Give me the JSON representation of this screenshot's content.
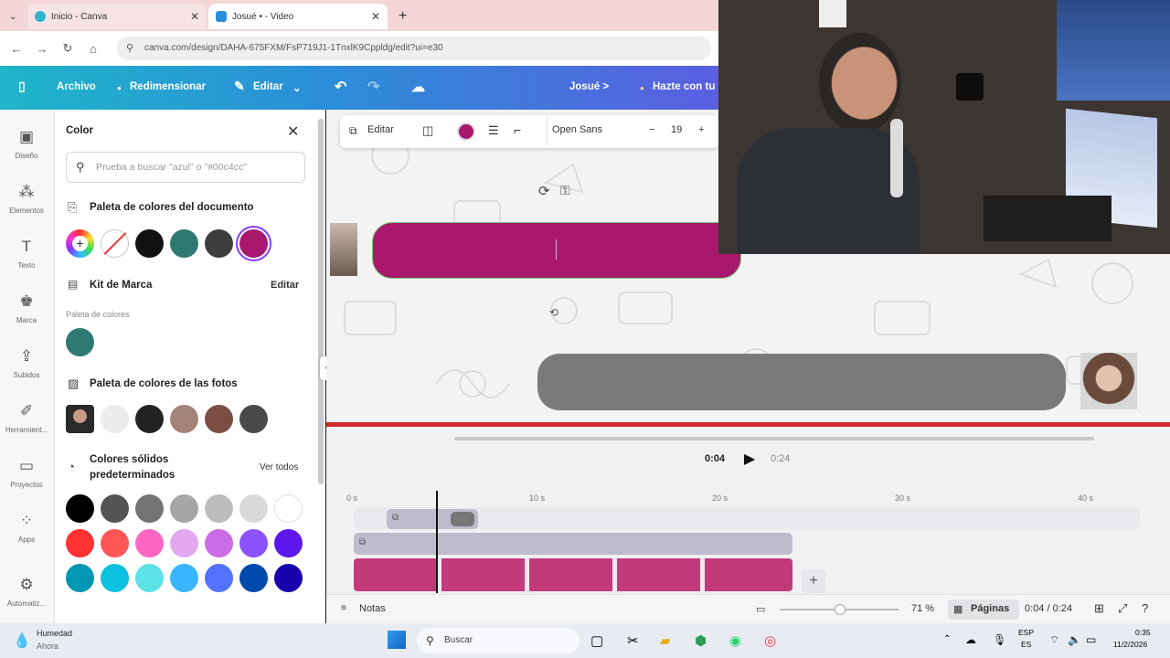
{
  "browser": {
    "tabs": [
      {
        "label": "Inicio - Canva"
      },
      {
        "label": "Josué • - Video"
      }
    ],
    "new_tab": "+",
    "url": "canva.com/design/DAHA-675FXM/FsP719J1-1TnxlK9Cppldg/edit?ui=e30"
  },
  "header": {
    "archivo": "Archivo",
    "redimensionar": "Redimensionar",
    "editar": "Editar",
    "title": "Josué >",
    "upgrade": "Hazte con tu"
  },
  "rail": [
    {
      "label": "Diseño",
      "icon": "design-icon"
    },
    {
      "label": "Elementos",
      "icon": "elements-icon"
    },
    {
      "label": "Texto",
      "icon": "text-icon"
    },
    {
      "label": "Marca",
      "icon": "brand-icon"
    },
    {
      "label": "Subidos",
      "icon": "upload-icon"
    },
    {
      "label": "Herramient...",
      "icon": "tools-icon"
    },
    {
      "label": "Proyectos",
      "icon": "folder-icon"
    },
    {
      "label": "Apps",
      "icon": "apps-icon"
    },
    {
      "label": "Automatiz...",
      "icon": "automation-icon"
    }
  ],
  "panel": {
    "title": "Color",
    "search_placeholder": "Prueba a buscar \"azul\" o \"#00c4cc\"",
    "doc_palette_title": "Paleta de colores del documento",
    "doc_palette": [
      "#121212",
      "#2e7a72",
      "#3d3d3d",
      "#a8186f"
    ],
    "brand_kit_title": "Kit de Marca",
    "brand_kit_edit": "Editar",
    "brand_palette_label": "Paleta de colores",
    "brand_palette": [
      "#2e7a72"
    ],
    "photo_palette_title": "Paleta de colores de las fotos",
    "photo_palette": [
      "#ececec",
      "#222222",
      "#a48478",
      "#7a4e44",
      "#4a4a4a"
    ],
    "solid_title_1": "Colores sólidos",
    "solid_title_2": "predeterminados",
    "see_all": "Ver todos",
    "solid_rows": [
      [
        "#000000",
        "#545454",
        "#737373",
        "#a6a6a6",
        "#bdbdbd",
        "#d9d9d9",
        "#ffffff"
      ],
      [
        "#ff3131",
        "#ff5757",
        "#ff66c4",
        "#e2a9f1",
        "#cb6ce6",
        "#8c52ff",
        "#5e17eb"
      ],
      [
        "#0097b2",
        "#0cc0df",
        "#5ce1e6",
        "#38b6ff",
        "#5271ff",
        "#004aad",
        "#1800ad"
      ],
      [
        "#00bf63",
        "#7ed957",
        "#c1ff72",
        "#ffde59",
        "#ffbd59",
        "#ff914d",
        "#ff751f"
      ]
    ]
  },
  "toolbar": {
    "edit": "Editar",
    "font": "Open Sans",
    "font_size": "19",
    "minus": "−",
    "plus": "+",
    "color": "#a8186f"
  },
  "timeline": {
    "current": "0:04",
    "total": "0:24",
    "ticks": [
      "0 s",
      "10 s",
      "20 s",
      "30 s",
      "40 s"
    ]
  },
  "footer": {
    "notes": "Notas",
    "zoom": "71 %",
    "pages": "Páginas",
    "time": "0:04 / 0:24"
  },
  "taskbar": {
    "weather_title": "Humedad",
    "weather_sub": "Ahora",
    "search": "Buscar",
    "lang_1": "ESP",
    "lang_2": "ES",
    "time": "0:35",
    "date": "11/2/2026"
  }
}
